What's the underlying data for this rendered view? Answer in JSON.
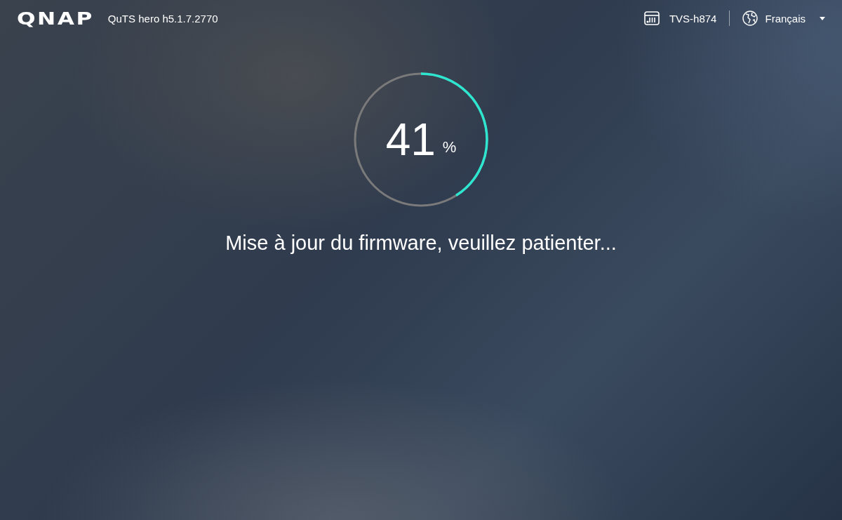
{
  "header": {
    "logo": "QNAP",
    "product": "QuTS hero h5.1.7.2770",
    "device": "TVS-h874",
    "language": "Français"
  },
  "progress": {
    "level": 0.41,
    "value": "41",
    "unit": "%"
  },
  "message": "Mise à jour du firmware, veuillez patienter..."
}
